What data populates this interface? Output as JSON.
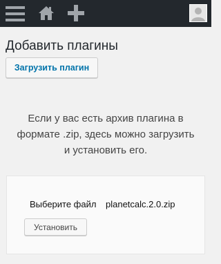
{
  "toolbar": {
    "menu_icon": "hamburger-menu-icon",
    "home_icon": "home-icon",
    "add_icon": "plus-icon",
    "avatar_icon": "user-avatar-icon",
    "bg_color": "#23282d"
  },
  "main": {
    "title": "Добавить плагины",
    "upload_button_label": "Загрузить плагин",
    "help_text": "Если у вас есть архив плагина в формате .zip, здесь можно загрузить и установить его."
  },
  "upload_form": {
    "file_button_label": "Выберите файл",
    "selected_file": "planetcalc.2.0.zip",
    "install_button_label": "Установить"
  }
}
